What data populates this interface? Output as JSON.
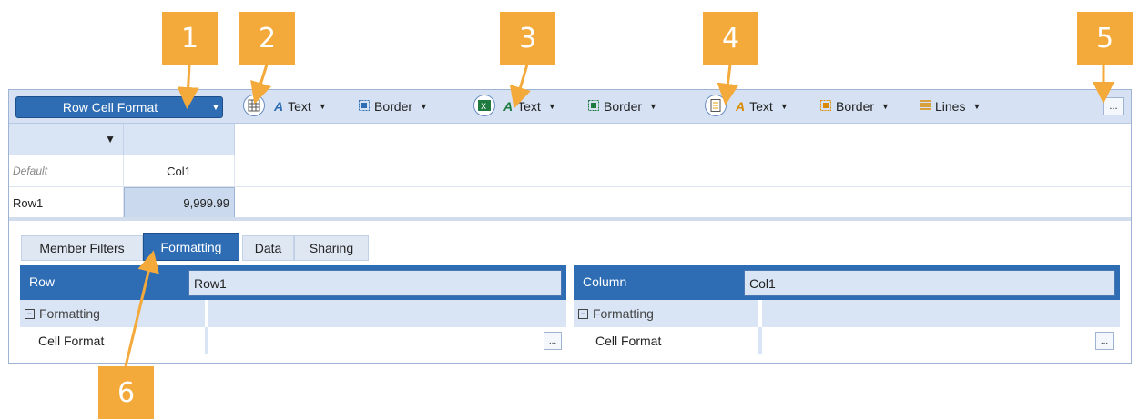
{
  "callouts": [
    "1",
    "2",
    "3",
    "4",
    "5",
    "6"
  ],
  "toolbar": {
    "dropdown_label": "Row Cell Format",
    "groups": [
      {
        "text_label": "Text",
        "border_label": "Border"
      },
      {
        "text_label": "Text",
        "border_label": "Border"
      },
      {
        "text_label": "Text",
        "border_label": "Border",
        "lines_label": "Lines"
      }
    ],
    "more_label": "..."
  },
  "grid": {
    "default_label": "Default",
    "col1": "Col1",
    "row1": "Row1",
    "value": "9,999.99"
  },
  "tabs": [
    "Member Filters",
    "Formatting",
    "Data",
    "Sharing"
  ],
  "active_tab": "Formatting",
  "row_panel": {
    "header": "Row",
    "value": "Row1",
    "category": "Formatting",
    "property": "Cell Format",
    "dots": "..."
  },
  "column_panel": {
    "header": "Column",
    "value": "Col1",
    "category": "Formatting",
    "property": "Cell Format",
    "dots": "..."
  },
  "colors": {
    "accent": "#2e6db4",
    "callout": "#f4a93b",
    "header_bg": "#d9e4f4"
  }
}
